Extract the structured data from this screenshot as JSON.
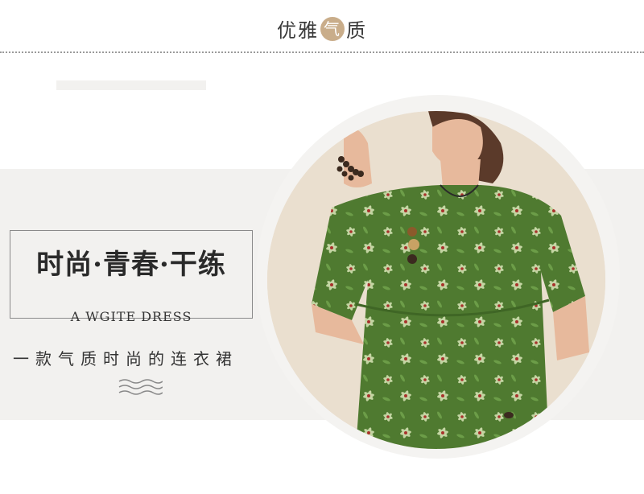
{
  "header": {
    "title_part1": "优雅",
    "title_circle_char": "气",
    "title_part2": "质"
  },
  "banner": {
    "main_title": "时尚·青春·干练",
    "subtitle_en": "A WGITE DRESS",
    "subtitle_cn": "一款气质时尚的连衣裙"
  },
  "colors": {
    "accent_circle": "#c9ad8a",
    "band_bg": "#f2f1ef",
    "dress_green": "#4f7a30"
  },
  "icons": [
    "wave-lines-icon"
  ]
}
